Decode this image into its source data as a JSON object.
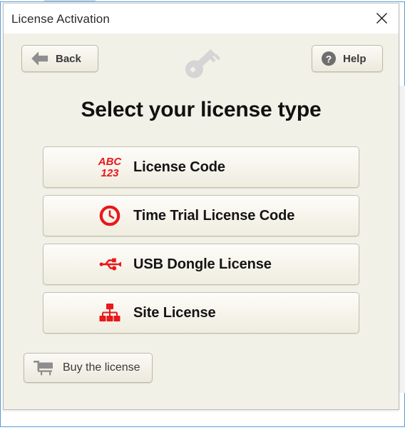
{
  "window": {
    "title": "License Activation",
    "close_icon": "close-x-icon",
    "background_color": "#f2f1e7",
    "titlebar_color": "#ffffff",
    "accent_color": "#e8181b"
  },
  "header": {
    "back": {
      "label": "Back",
      "icon": "arrow-left-icon"
    },
    "help": {
      "label": "Help",
      "icon": "question-mark-circle-icon"
    },
    "decoration_icon": "key-icon"
  },
  "main": {
    "heading": "Select your license type",
    "options": [
      {
        "label": "License Code",
        "icon": "abc-123-icon",
        "icon_text_top": "ABC",
        "icon_text_bottom": "123"
      },
      {
        "label": "Time Trial License Code",
        "icon": "clock-icon"
      },
      {
        "label": "USB Dongle License",
        "icon": "usb-icon"
      },
      {
        "label": "Site License",
        "icon": "network-hierarchy-icon"
      }
    ]
  },
  "footer": {
    "buy": {
      "label": "Buy the license",
      "icon": "shopping-cart-icon"
    }
  }
}
